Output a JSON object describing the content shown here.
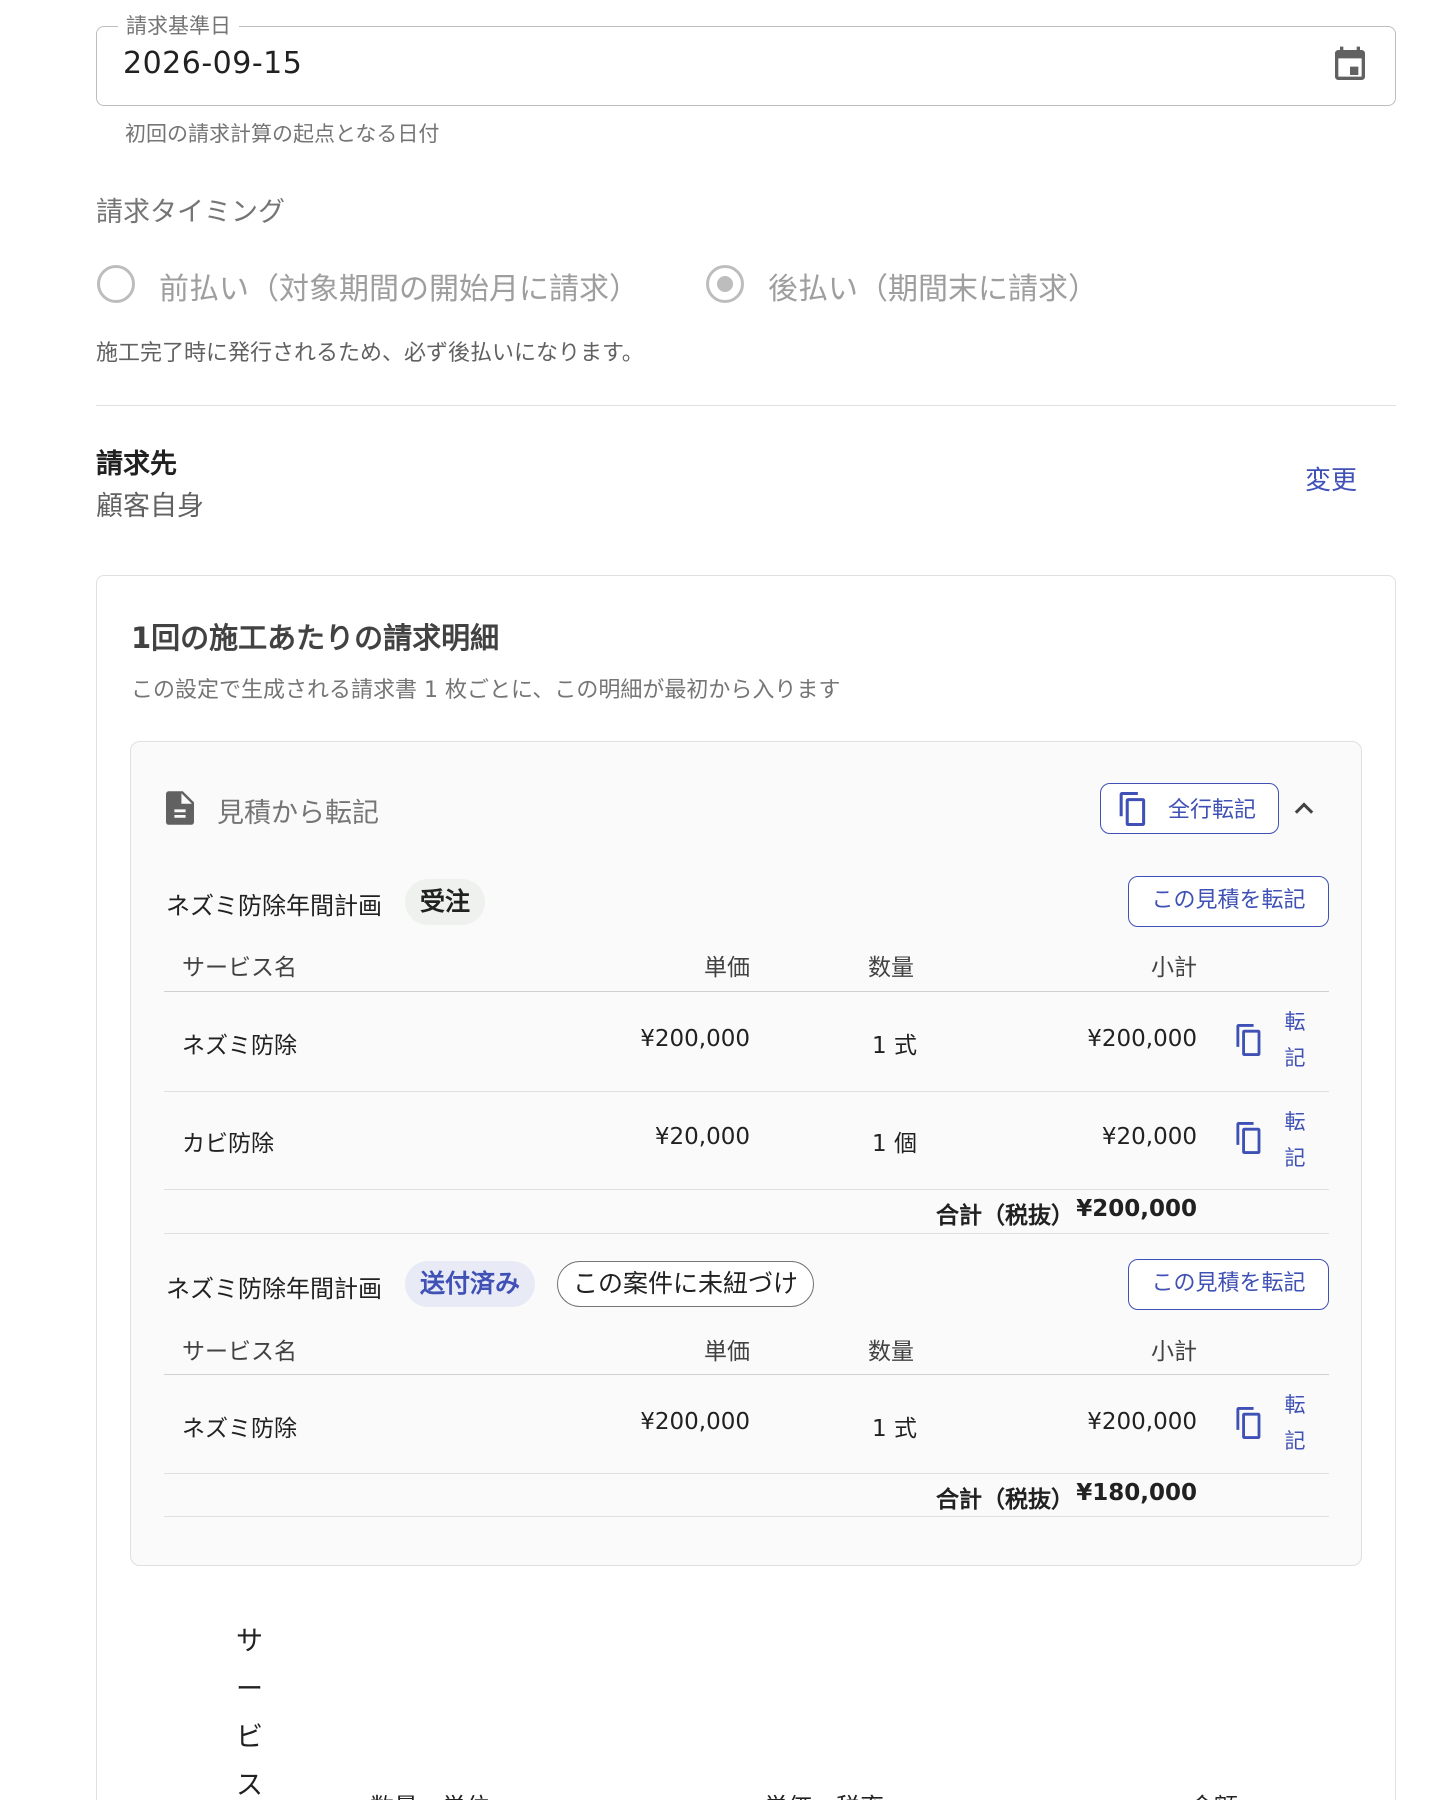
{
  "billing_date": {
    "label": "請求基準日",
    "value": "2026-09-15",
    "helper": "初回の請求計算の起点となる日付",
    "icon": "calendar-icon"
  },
  "timing": {
    "label": "請求タイミング",
    "options": [
      {
        "label": "前払い（対象期間の開始月に請求）",
        "selected": false
      },
      {
        "label": "後払い（期間末に請求）",
        "selected": true
      }
    ],
    "note": "施工完了時に発行されるため、必ず後払いになります。"
  },
  "bill_to": {
    "title": "請求先",
    "value": "顧客自身",
    "change_label": "変更"
  },
  "statement": {
    "title": "1回の施工あたりの請求明細",
    "subtitle": "この設定で生成される請求書 1 枚ごとに、この明細が最初から入ります"
  },
  "quote_panel": {
    "title": "見積から転記",
    "copy_all_label": "全行転記",
    "groups": [
      {
        "name": "ネズミ防除年間計画",
        "status": "受注",
        "copy_label": "この見積を転記",
        "headers": [
          "サービス名",
          "単価",
          "数量",
          "小計"
        ],
        "rows": [
          {
            "service": "ネズミ防除",
            "unit_price": "¥200,000",
            "qty": "1 式",
            "subtotal": "¥200,000",
            "copy": "転記"
          },
          {
            "service": "カビ防除",
            "unit_price": "¥20,000",
            "qty": "1 個",
            "subtotal": "¥20,000",
            "copy": "転記"
          }
        ],
        "total_label": "合計（税抜）",
        "total_value": "¥200,000"
      },
      {
        "name": "ネズミ防除年間計画",
        "status": "送付済み",
        "extra_chip": "この案件に未紐づけ",
        "copy_label": "この見積を転記",
        "headers": [
          "サービス名",
          "単価",
          "数量",
          "小計"
        ],
        "rows": [
          {
            "service": "ネズミ防除",
            "unit_price": "¥200,000",
            "qty": "1 式",
            "subtotal": "¥200,000",
            "copy": "転記"
          }
        ],
        "total_label": "合計（税抜）",
        "total_value": "¥180,000"
      }
    ]
  },
  "items_table": {
    "service_header_chars": [
      "サ",
      "ー",
      "ビ",
      "ス"
    ],
    "headers": [
      "数量・単位",
      "単価・税率",
      "金額"
    ]
  }
}
